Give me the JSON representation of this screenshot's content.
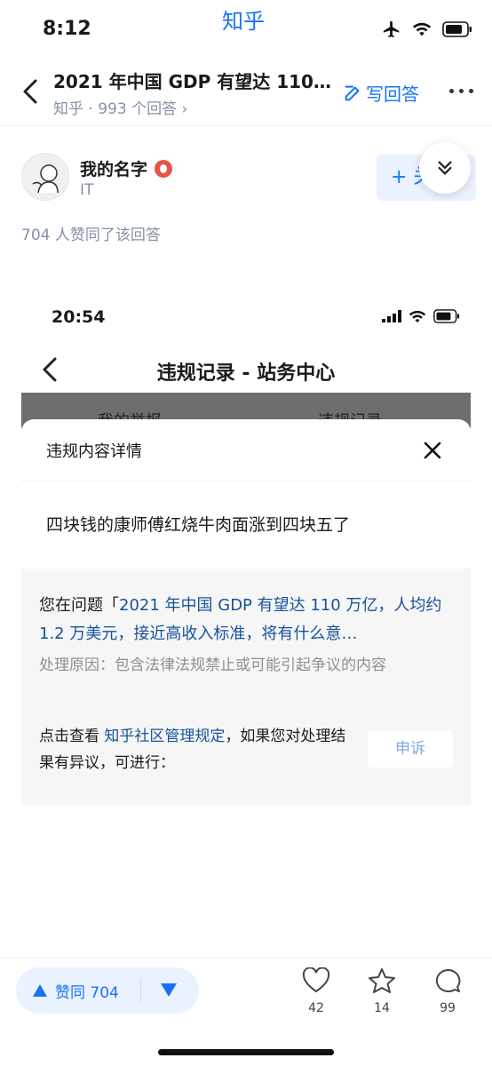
{
  "status_bar": {
    "time": "8:12",
    "app_name": "知乎"
  },
  "nav": {
    "title": "2021 年中国 GDP 有望达 110…",
    "subtitle": "知乎 · 993 个回答 ›",
    "write_answer": "写回答"
  },
  "author": {
    "name": "我的名字",
    "tag": "IT",
    "follow": "+ 关"
  },
  "vote_summary": "704 人赞同了该回答",
  "screenshot": {
    "time": "20:54",
    "title": "违规记录 - 站务中心",
    "tabs": [
      "我的举报",
      "违规记录"
    ],
    "sheet_title": "违规内容详情",
    "content": "四块钱的康师傅红烧牛肉面涨到四块五了",
    "question_prefix": "您在问题「",
    "question_link": "2021 年中国 GDP 有望达 110 万亿，人均约 1.2 万美元，接近高收入标准，将有什么意…",
    "reason": "处理原因：包含法律法规禁止或可能引起争议的内容",
    "rule_prefix": "点击查看 ",
    "rule_link": "知乎社区管理规定",
    "rule_suffix": "，如果您对处理结果有异议，可进行：",
    "appeal": "申诉"
  },
  "bottom_bar": {
    "upvote_label": "赞同 704",
    "like_count": "42",
    "star_count": "14",
    "comment_count": "99"
  },
  "colors": {
    "accent": "#1772f6",
    "link": "#175199",
    "muted": "#8590a6"
  }
}
